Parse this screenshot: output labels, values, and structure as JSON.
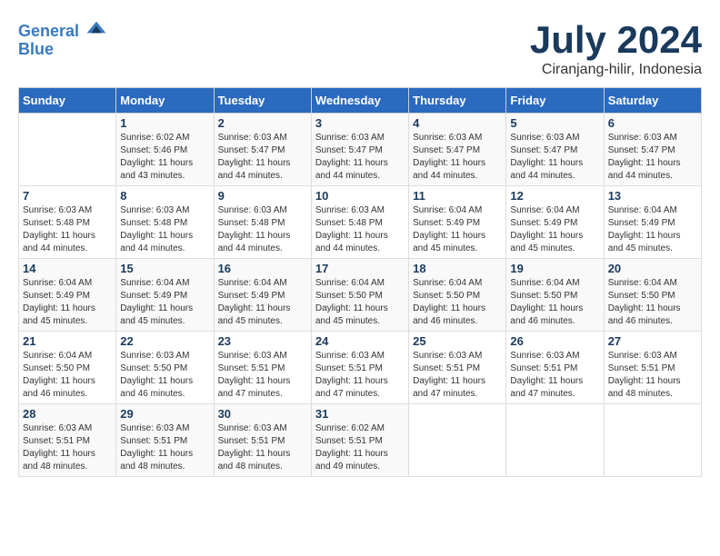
{
  "header": {
    "logo_line1": "General",
    "logo_line2": "Blue",
    "title": "July 2024",
    "subtitle": "Ciranjang-hilir, Indonesia"
  },
  "weekdays": [
    "Sunday",
    "Monday",
    "Tuesday",
    "Wednesday",
    "Thursday",
    "Friday",
    "Saturday"
  ],
  "weeks": [
    [
      {
        "day": "",
        "info": ""
      },
      {
        "day": "1",
        "info": "Sunrise: 6:02 AM\nSunset: 5:46 PM\nDaylight: 11 hours\nand 43 minutes."
      },
      {
        "day": "2",
        "info": "Sunrise: 6:03 AM\nSunset: 5:47 PM\nDaylight: 11 hours\nand 44 minutes."
      },
      {
        "day": "3",
        "info": "Sunrise: 6:03 AM\nSunset: 5:47 PM\nDaylight: 11 hours\nand 44 minutes."
      },
      {
        "day": "4",
        "info": "Sunrise: 6:03 AM\nSunset: 5:47 PM\nDaylight: 11 hours\nand 44 minutes."
      },
      {
        "day": "5",
        "info": "Sunrise: 6:03 AM\nSunset: 5:47 PM\nDaylight: 11 hours\nand 44 minutes."
      },
      {
        "day": "6",
        "info": "Sunrise: 6:03 AM\nSunset: 5:47 PM\nDaylight: 11 hours\nand 44 minutes."
      }
    ],
    [
      {
        "day": "7",
        "info": "Sunrise: 6:03 AM\nSunset: 5:48 PM\nDaylight: 11 hours\nand 44 minutes."
      },
      {
        "day": "8",
        "info": "Sunrise: 6:03 AM\nSunset: 5:48 PM\nDaylight: 11 hours\nand 44 minutes."
      },
      {
        "day": "9",
        "info": "Sunrise: 6:03 AM\nSunset: 5:48 PM\nDaylight: 11 hours\nand 44 minutes."
      },
      {
        "day": "10",
        "info": "Sunrise: 6:03 AM\nSunset: 5:48 PM\nDaylight: 11 hours\nand 44 minutes."
      },
      {
        "day": "11",
        "info": "Sunrise: 6:04 AM\nSunset: 5:49 PM\nDaylight: 11 hours\nand 45 minutes."
      },
      {
        "day": "12",
        "info": "Sunrise: 6:04 AM\nSunset: 5:49 PM\nDaylight: 11 hours\nand 45 minutes."
      },
      {
        "day": "13",
        "info": "Sunrise: 6:04 AM\nSunset: 5:49 PM\nDaylight: 11 hours\nand 45 minutes."
      }
    ],
    [
      {
        "day": "14",
        "info": "Sunrise: 6:04 AM\nSunset: 5:49 PM\nDaylight: 11 hours\nand 45 minutes."
      },
      {
        "day": "15",
        "info": "Sunrise: 6:04 AM\nSunset: 5:49 PM\nDaylight: 11 hours\nand 45 minutes."
      },
      {
        "day": "16",
        "info": "Sunrise: 6:04 AM\nSunset: 5:49 PM\nDaylight: 11 hours\nand 45 minutes."
      },
      {
        "day": "17",
        "info": "Sunrise: 6:04 AM\nSunset: 5:50 PM\nDaylight: 11 hours\nand 45 minutes."
      },
      {
        "day": "18",
        "info": "Sunrise: 6:04 AM\nSunset: 5:50 PM\nDaylight: 11 hours\nand 46 minutes."
      },
      {
        "day": "19",
        "info": "Sunrise: 6:04 AM\nSunset: 5:50 PM\nDaylight: 11 hours\nand 46 minutes."
      },
      {
        "day": "20",
        "info": "Sunrise: 6:04 AM\nSunset: 5:50 PM\nDaylight: 11 hours\nand 46 minutes."
      }
    ],
    [
      {
        "day": "21",
        "info": "Sunrise: 6:04 AM\nSunset: 5:50 PM\nDaylight: 11 hours\nand 46 minutes."
      },
      {
        "day": "22",
        "info": "Sunrise: 6:03 AM\nSunset: 5:50 PM\nDaylight: 11 hours\nand 46 minutes."
      },
      {
        "day": "23",
        "info": "Sunrise: 6:03 AM\nSunset: 5:51 PM\nDaylight: 11 hours\nand 47 minutes."
      },
      {
        "day": "24",
        "info": "Sunrise: 6:03 AM\nSunset: 5:51 PM\nDaylight: 11 hours\nand 47 minutes."
      },
      {
        "day": "25",
        "info": "Sunrise: 6:03 AM\nSunset: 5:51 PM\nDaylight: 11 hours\nand 47 minutes."
      },
      {
        "day": "26",
        "info": "Sunrise: 6:03 AM\nSunset: 5:51 PM\nDaylight: 11 hours\nand 47 minutes."
      },
      {
        "day": "27",
        "info": "Sunrise: 6:03 AM\nSunset: 5:51 PM\nDaylight: 11 hours\nand 48 minutes."
      }
    ],
    [
      {
        "day": "28",
        "info": "Sunrise: 6:03 AM\nSunset: 5:51 PM\nDaylight: 11 hours\nand 48 minutes."
      },
      {
        "day": "29",
        "info": "Sunrise: 6:03 AM\nSunset: 5:51 PM\nDaylight: 11 hours\nand 48 minutes."
      },
      {
        "day": "30",
        "info": "Sunrise: 6:03 AM\nSunset: 5:51 PM\nDaylight: 11 hours\nand 48 minutes."
      },
      {
        "day": "31",
        "info": "Sunrise: 6:02 AM\nSunset: 5:51 PM\nDaylight: 11 hours\nand 49 minutes."
      },
      {
        "day": "",
        "info": ""
      },
      {
        "day": "",
        "info": ""
      },
      {
        "day": "",
        "info": ""
      }
    ]
  ]
}
